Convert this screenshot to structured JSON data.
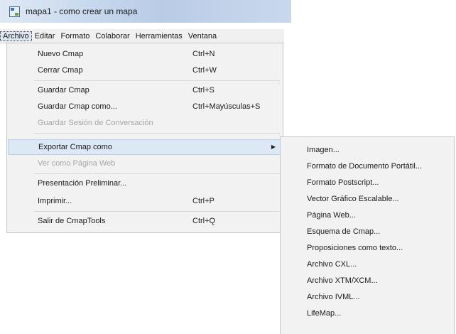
{
  "window": {
    "title": "mapa1 - como crear un mapa"
  },
  "menubar": {
    "items": [
      "Archivo",
      "Editar",
      "Formato",
      "Colaborar",
      "Herramientas",
      "Ventana"
    ]
  },
  "archivo_menu": {
    "items": [
      {
        "label": "Nuevo Cmap",
        "shortcut": "Ctrl+N"
      },
      {
        "label": "Cerrar Cmap",
        "shortcut": "Ctrl+W"
      },
      {
        "label": "Guardar Cmap",
        "shortcut": "Ctrl+S"
      },
      {
        "label": "Guardar Cmap como...",
        "shortcut": "Ctrl+Mayúsculas+S"
      },
      {
        "label": "Guardar Sesión de Conversación",
        "shortcut": "",
        "disabled": true
      },
      {
        "label": "Exportar Cmap como",
        "shortcut": "",
        "highlighted": true,
        "has_submenu": true
      },
      {
        "label": "Ver como Página Web",
        "shortcut": "",
        "disabled": true
      },
      {
        "label": "Presentación Preliminar...",
        "shortcut": ""
      },
      {
        "label": "Imprimir...",
        "shortcut": "Ctrl+P"
      },
      {
        "label": "Salir de CmapTools",
        "shortcut": "Ctrl+Q"
      }
    ]
  },
  "export_submenu": {
    "items": [
      "Imagen...",
      "Formato de Documento Portátil...",
      "Formato Postscript...",
      "Vector Gráfico Escalable...",
      "Página Web...",
      "Esquema de Cmap...",
      "Proposiciones como texto...",
      "Archivo CXL...",
      "Archivo XTM/XCM...",
      "Archivo IVML...",
      "LifeMap..."
    ]
  }
}
